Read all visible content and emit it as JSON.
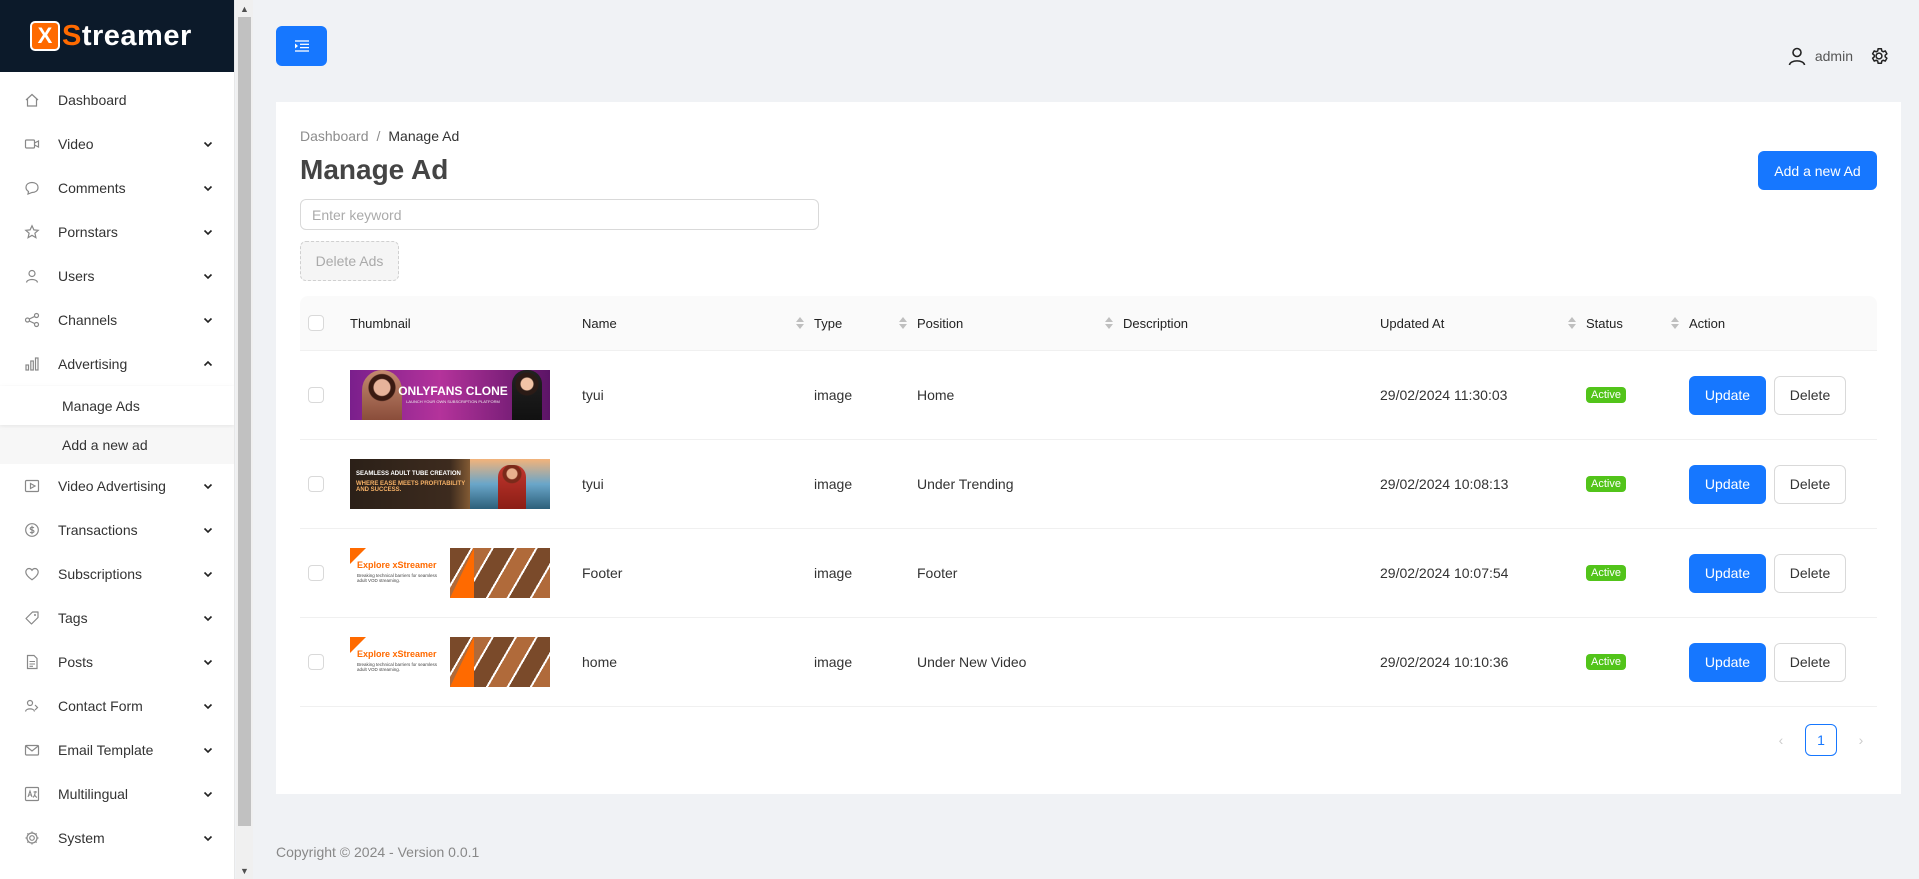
{
  "brand": {
    "logo_letter": "X",
    "name_first": "S",
    "name_rest": "treamer"
  },
  "sidebar": {
    "items": [
      {
        "label": "Dashboard",
        "icon": "home-icon",
        "has_children": false
      },
      {
        "label": "Video",
        "icon": "video-icon",
        "has_children": true
      },
      {
        "label": "Comments",
        "icon": "comment-icon",
        "has_children": true
      },
      {
        "label": "Pornstars",
        "icon": "star-icon",
        "has_children": true
      },
      {
        "label": "Users",
        "icon": "user-icon",
        "has_children": true
      },
      {
        "label": "Channels",
        "icon": "channels-icon",
        "has_children": true
      },
      {
        "label": "Advertising",
        "icon": "advertising-icon",
        "has_children": true,
        "expanded": true
      }
    ],
    "sub_items": [
      {
        "label": "Manage Ads",
        "active": true
      },
      {
        "label": "Add a new ad",
        "active": false
      }
    ],
    "items_after": [
      {
        "label": "Video Advertising",
        "icon": "video-ad-icon"
      },
      {
        "label": "Transactions",
        "icon": "dollar-icon"
      },
      {
        "label": "Subscriptions",
        "icon": "heart-icon"
      },
      {
        "label": "Tags",
        "icon": "tag-icon"
      },
      {
        "label": "Posts",
        "icon": "file-icon"
      },
      {
        "label": "Contact Form",
        "icon": "contact-icon"
      },
      {
        "label": "Email Template",
        "icon": "mail-icon"
      },
      {
        "label": "Multilingual",
        "icon": "language-icon"
      },
      {
        "label": "System",
        "icon": "gear-icon"
      }
    ]
  },
  "topbar": {
    "user": "admin"
  },
  "breadcrumb": {
    "root": "Dashboard",
    "separator": "/",
    "current": "Manage Ad"
  },
  "page": {
    "title": "Manage Ad",
    "add_button": "Add a new Ad",
    "search_placeholder": "Enter keyword",
    "delete_button": "Delete Ads"
  },
  "table": {
    "headers": {
      "thumbnail": "Thumbnail",
      "name": "Name",
      "type": "Type",
      "position": "Position",
      "description": "Description",
      "updated_at": "Updated At",
      "status": "Status",
      "action": "Action"
    },
    "rows": [
      {
        "name": "tyui",
        "type": "image",
        "position": "Home",
        "description": "",
        "updated_at": "29/02/2024 11:30:03",
        "status": "Active",
        "thumb": "onlyfans",
        "thumb_text": "ONLYFANS CLONE",
        "thumb_sub": "LAUNCH YOUR OWN SUBSCRIPTION PLATFORM"
      },
      {
        "name": "tyui",
        "type": "image",
        "position": "Under Trending",
        "description": "",
        "updated_at": "29/02/2024 10:08:13",
        "status": "Active",
        "thumb": "seamless",
        "thumb_text": "SEAMLESS ADULT TUBE CREATION",
        "thumb_sub": "WHERE EASE MEETS PROFITABILITY AND SUCCESS."
      },
      {
        "name": "Footer",
        "type": "image",
        "position": "Footer",
        "description": "",
        "updated_at": "29/02/2024 10:07:54",
        "status": "Active",
        "thumb": "explore",
        "thumb_text": "Explore xStreamer",
        "thumb_sub": "Breaking technical barriers for seamless adult VOD streaming."
      },
      {
        "name": "home",
        "type": "image",
        "position": "Under New Video",
        "description": "",
        "updated_at": "29/02/2024 10:10:36",
        "status": "Active",
        "thumb": "explore",
        "thumb_text": "Explore xStreamer",
        "thumb_sub": "Breaking technical barriers for seamless adult VOD streaming."
      }
    ],
    "update_label": "Update",
    "delete_label": "Delete"
  },
  "pagination": {
    "current": "1"
  },
  "footer": {
    "text": "Copyright © 2024 - Version 0.0.1"
  },
  "colors": {
    "primary": "#1677ff",
    "brand_orange": "#ff6a00",
    "active_badge": "#52c41a",
    "logo_bg": "#0c1a2a"
  }
}
